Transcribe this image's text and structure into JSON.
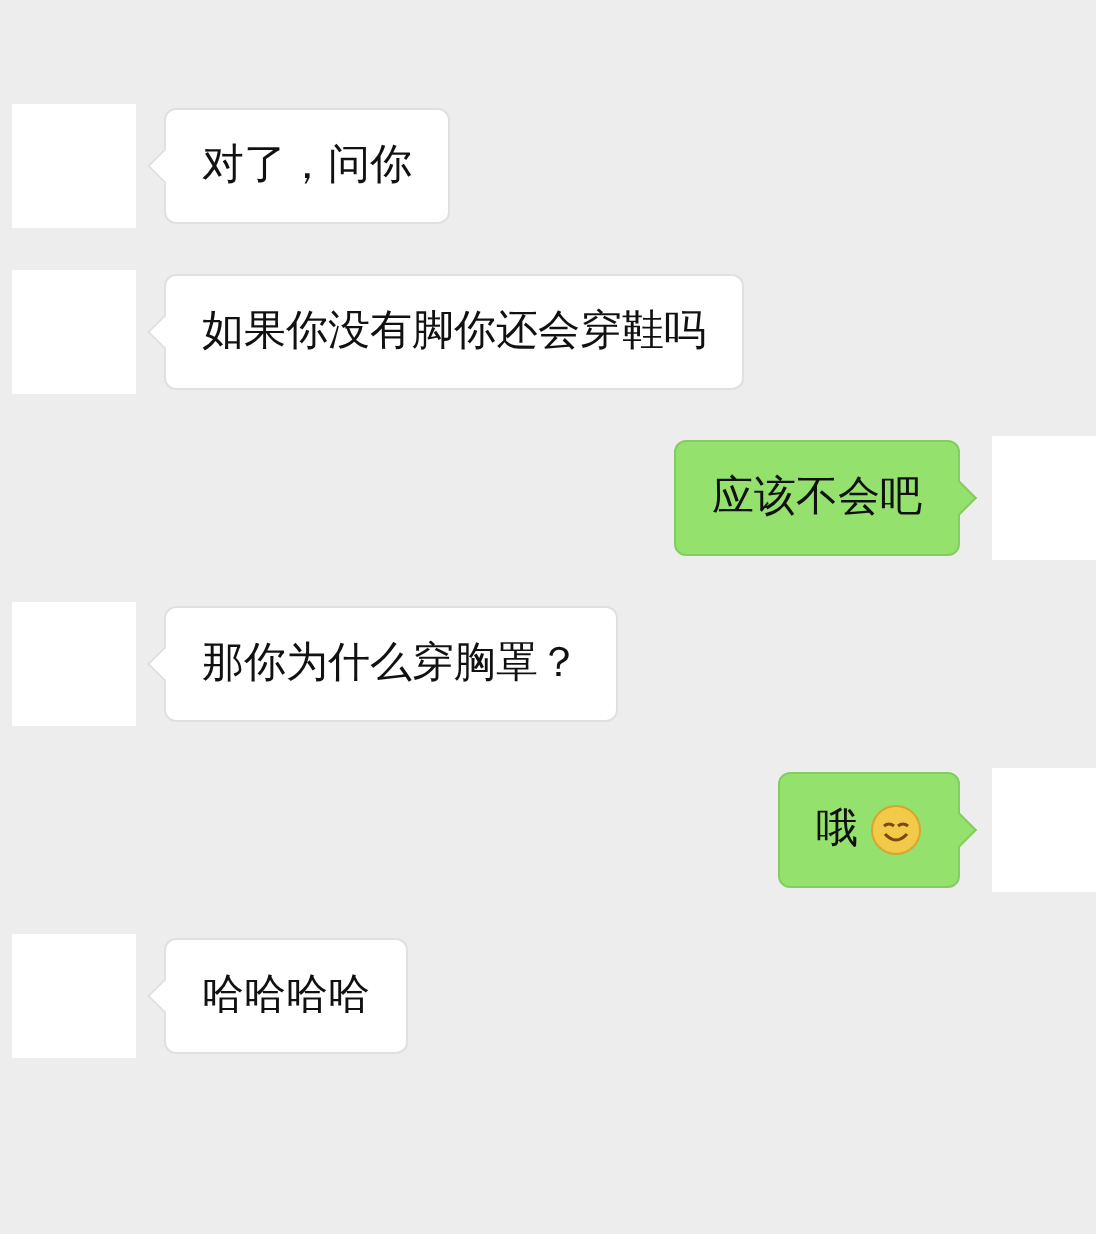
{
  "messages": [
    {
      "kind": "received",
      "text": "对了，问你"
    },
    {
      "kind": "received",
      "text": "如果你没有脚你还会穿鞋吗"
    },
    {
      "kind": "sent",
      "text": "应该不会吧"
    },
    {
      "kind": "received",
      "text": "那你为什么穿胸罩？"
    },
    {
      "kind": "sent",
      "text": "哦",
      "emoji": true
    },
    {
      "kind": "received",
      "text": "哈哈哈哈"
    }
  ]
}
